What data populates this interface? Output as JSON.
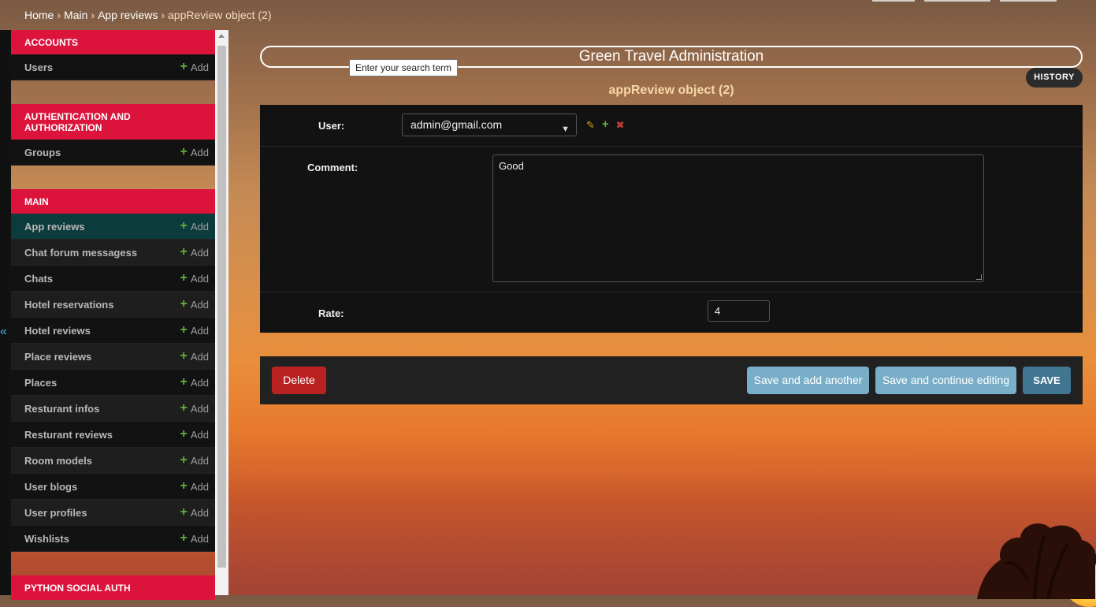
{
  "breadcrumb": {
    "home": "Home",
    "main": "Main",
    "app_reviews": "App reviews",
    "current": "appReview object (2)",
    "separator": "›"
  },
  "collapse_icon": "«",
  "sidebar": {
    "modules": [
      {
        "title": "Accounts",
        "models": [
          {
            "name": "Users",
            "add": "Add"
          }
        ]
      },
      {
        "title": "Authentication and Authorization",
        "models": [
          {
            "name": "Groups",
            "add": "Add"
          }
        ]
      },
      {
        "title": "Main",
        "models": [
          {
            "name": "App reviews",
            "add": "Add",
            "active": true
          },
          {
            "name": "Chat forum messagess",
            "add": "Add"
          },
          {
            "name": "Chats",
            "add": "Add"
          },
          {
            "name": "Hotel reservations",
            "add": "Add"
          },
          {
            "name": "Hotel reviews",
            "add": "Add"
          },
          {
            "name": "Place reviews",
            "add": "Add"
          },
          {
            "name": "Places",
            "add": "Add"
          },
          {
            "name": "Resturant infos",
            "add": "Add"
          },
          {
            "name": "Resturant reviews",
            "add": "Add"
          },
          {
            "name": "Room models",
            "add": "Add"
          },
          {
            "name": "User blogs",
            "add": "Add"
          },
          {
            "name": "User profiles",
            "add": "Add"
          },
          {
            "name": "Wishlists",
            "add": "Add"
          }
        ]
      },
      {
        "title": "Python Social Auth",
        "models": []
      }
    ]
  },
  "header": {
    "site_title": "Green Travel Administration",
    "tooltip": "Enter your search term",
    "history_label": "HISTORY",
    "page_heading": "appReview object (2)"
  },
  "form": {
    "user_label": "User:",
    "user_value": "admin@gmail.com",
    "comment_label": "Comment:",
    "comment_value": "Good",
    "rate_label": "Rate:",
    "rate_value": "4"
  },
  "actions": {
    "delete": "Delete",
    "save_add_another": "Save and add another",
    "save_continue": "Save and continue editing",
    "save": "SAVE"
  },
  "icons": {
    "add": "plus-icon",
    "change": "pencil-icon",
    "remove": "delete-icon"
  },
  "colors": {
    "module_header": "#dc143c",
    "active_row": "#0c3b3b",
    "add_green": "#5fb33b",
    "delete_red": "#ba2121",
    "secondary_button": "#79aec8",
    "save_button": "#417690",
    "heading_text": "#f6d7a8"
  }
}
